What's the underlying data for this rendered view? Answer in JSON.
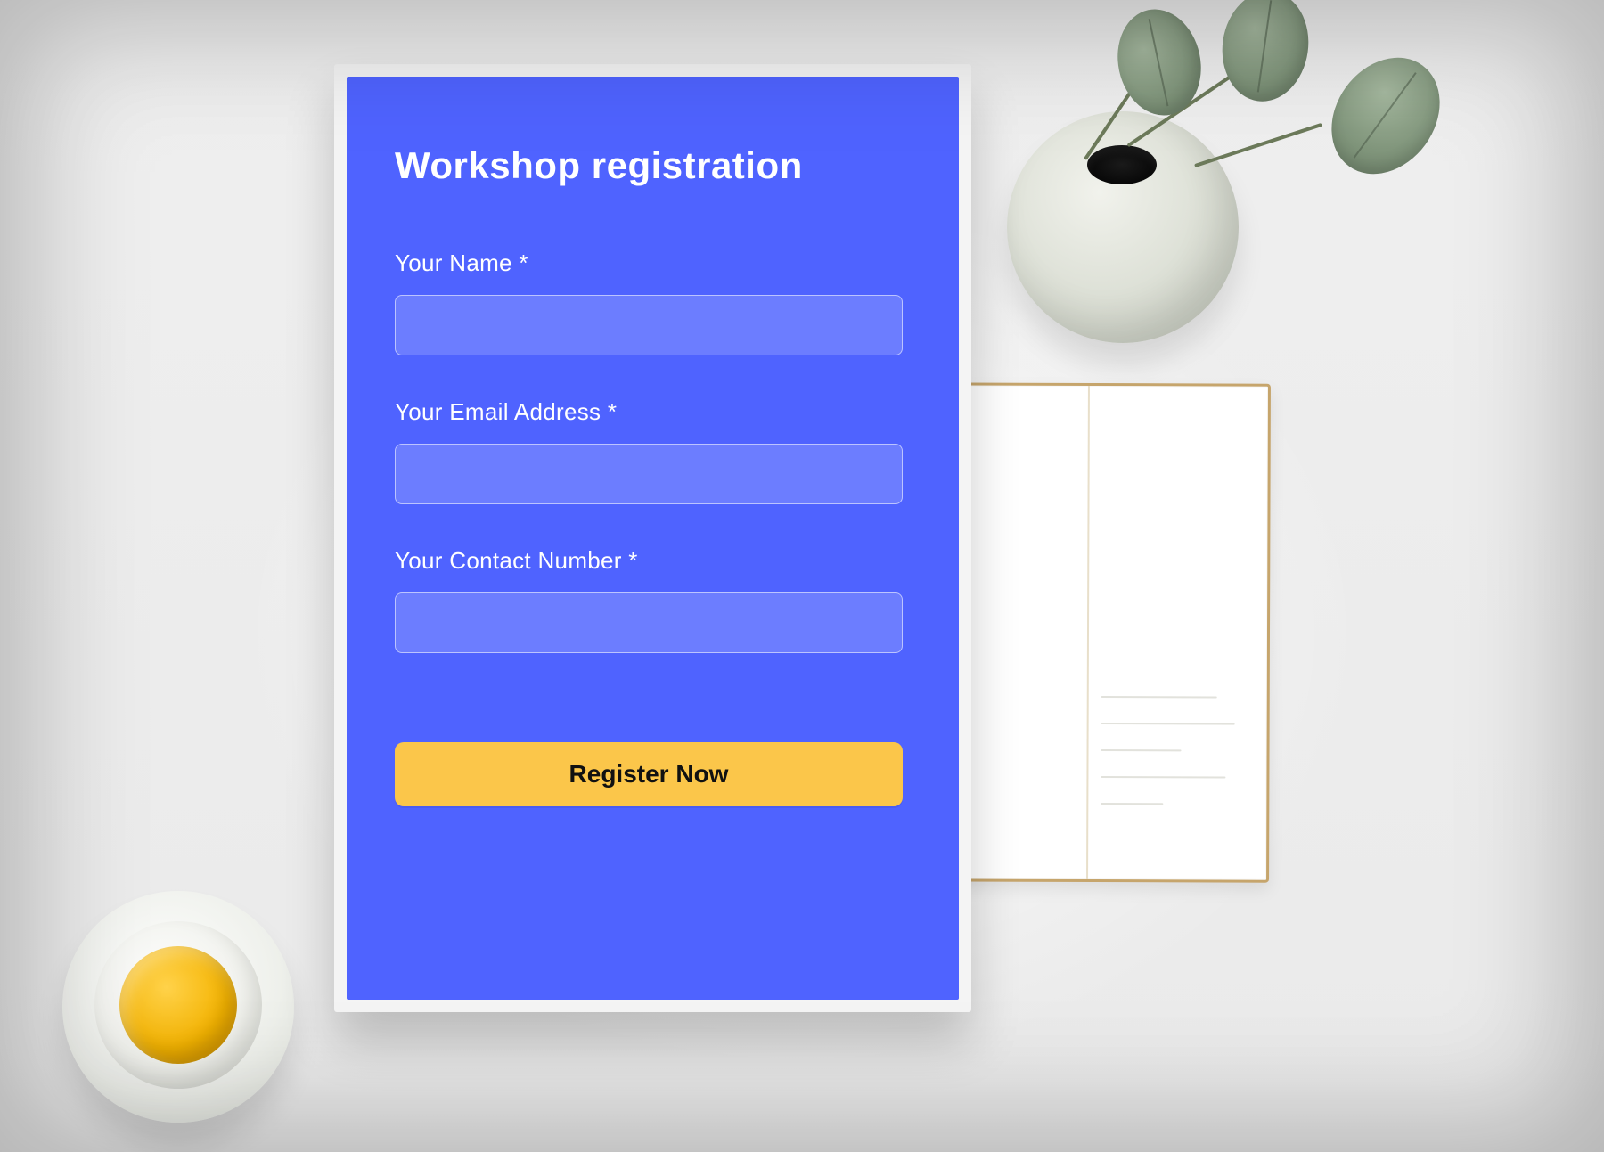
{
  "form": {
    "title": "Workshop registration",
    "fields": {
      "name": {
        "label": "Your Name *",
        "value": "",
        "placeholder": ""
      },
      "email": {
        "label": "Your Email Address *",
        "value": "",
        "placeholder": ""
      },
      "contact": {
        "label": "Your Contact Number *",
        "value": "",
        "placeholder": ""
      }
    },
    "submit_label": "Register Now"
  },
  "colors": {
    "card_bg": "#4f63ff",
    "input_bg": "#6c7dff",
    "button_bg": "#fbc64a"
  }
}
